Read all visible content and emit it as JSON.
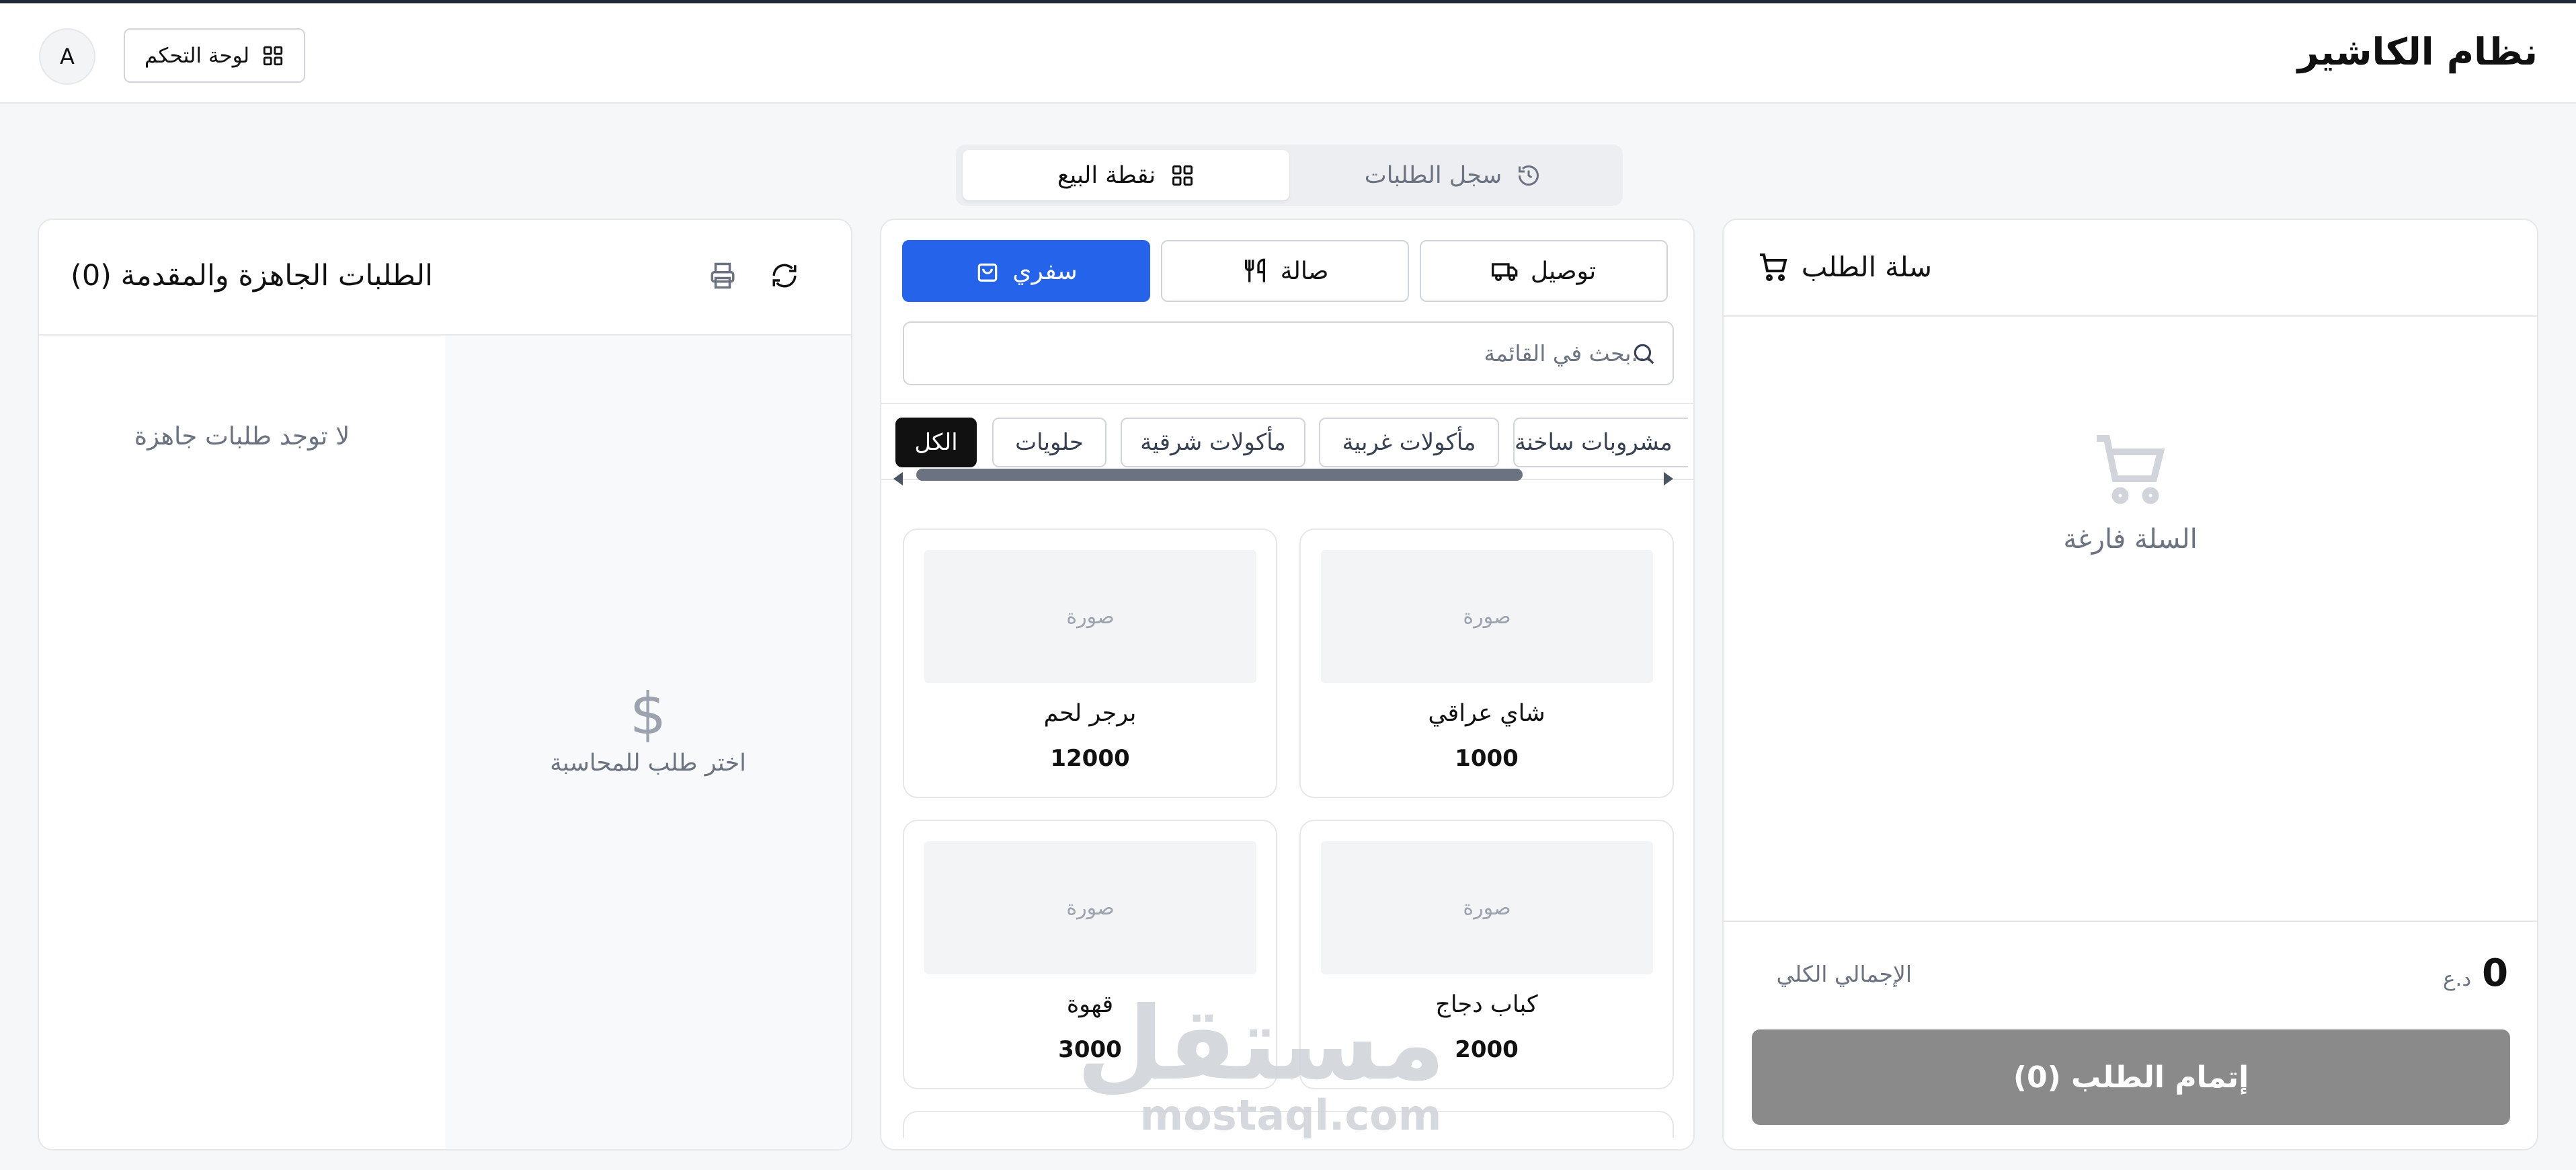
{
  "header": {
    "title": "نظام الكاشير",
    "dashboard_label": "لوحة التحكم",
    "avatar_initial": "A"
  },
  "mode_tabs": {
    "pos": "نقطة البيع",
    "history": "سجل الطلبات"
  },
  "cart": {
    "title": "سلة الطلب",
    "empty_text": "السلة فارغة",
    "total_label": "الإجمالي الكلي",
    "total_value": "0",
    "currency": "د.ع",
    "checkout_label": "إتمام الطلب (0)"
  },
  "order_types": {
    "delivery": "توصيل",
    "dine_in": "صالة",
    "takeaway": "سفري"
  },
  "search": {
    "placeholder": "...بحث في القائمة"
  },
  "categories": [
    "الكل",
    "حلويات",
    "مأكولات شرقية",
    "مأكولات غربية",
    "مشروبات ساخنة"
  ],
  "products": [
    {
      "name": "شاي عراقي",
      "price": "1000",
      "image_placeholder": "صورة"
    },
    {
      "name": "برجر لحم",
      "price": "12000",
      "image_placeholder": "صورة"
    },
    {
      "name": "كباب دجاج",
      "price": "2000",
      "image_placeholder": "صورة"
    },
    {
      "name": "قهوة",
      "price": "3000",
      "image_placeholder": "صورة"
    }
  ],
  "orders": {
    "title": "الطلبات الجاهزة والمقدمة (0)",
    "no_orders": "لا توجد طلبات جاهزة",
    "select_prompt": "اختر طلب للمحاسبة",
    "dollar_symbol": "$"
  },
  "watermark": {
    "arabic": "مستقل",
    "latin": "mostaql.com"
  },
  "colors": {
    "accent": "#2563eb",
    "checkout_disabled": "#8a8a8a",
    "active_chip": "#111111"
  }
}
